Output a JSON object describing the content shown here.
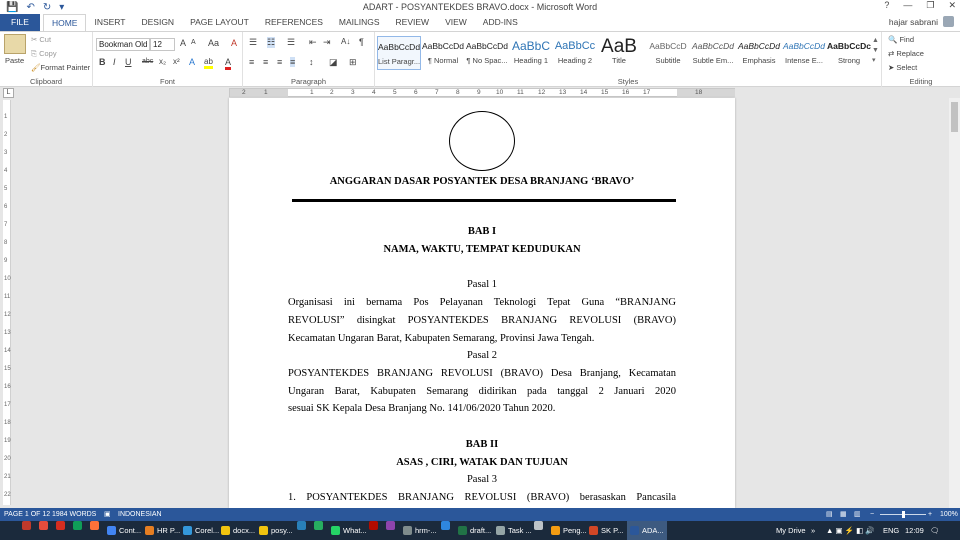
{
  "window": {
    "title": "ADART - POSYANTEKDES BRAVO.docx - Microsoft Word",
    "help": "?",
    "minimize": "—",
    "restore": "❐",
    "close": "✕"
  },
  "quick_access": {
    "save": "💾",
    "undo": "↶",
    "redo": "↻",
    "customize": "▾"
  },
  "tabs": [
    "FILE",
    "HOME",
    "INSERT",
    "DESIGN",
    "PAGE LAYOUT",
    "REFERENCES",
    "MAILINGS",
    "REVIEW",
    "VIEW",
    "ADD-INS"
  ],
  "user": {
    "name": "hajar sabrani"
  },
  "clipboard": {
    "paste": "Paste",
    "cut": "Cut",
    "copy": "Copy",
    "format_painter": "Format Painter",
    "label": "Clipboard"
  },
  "font": {
    "name": "Bookman Old",
    "size": "12",
    "label": "Font",
    "bold": "B",
    "italic": "I",
    "underline": "U",
    "strike": "abc",
    "sub": "x₂",
    "sup": "x²",
    "grow": "A",
    "shrink": "A",
    "case": "Aa",
    "clear": "A",
    "color": "A",
    "highlight": "ab"
  },
  "paragraph": {
    "label": "Paragraph",
    "show_marks": "¶",
    "sort": "A↓"
  },
  "styles": {
    "label": "Styles",
    "items": [
      {
        "preview": "AaBbCcDd",
        "name": "List Paragr..."
      },
      {
        "preview": "AaBbCcDd",
        "name": "¶ Normal"
      },
      {
        "preview": "AaBbCcDd",
        "name": "¶ No Spac..."
      },
      {
        "preview": "AaBbC",
        "name": "Heading 1"
      },
      {
        "preview": "AaBbCc",
        "name": "Heading 2"
      },
      {
        "preview": "AaB",
        "name": "Title"
      },
      {
        "preview": "AaBbCcD",
        "name": "Subtitle"
      },
      {
        "preview": "AaBbCcDd",
        "name": "Subtle Em..."
      },
      {
        "preview": "AaBbCcDd",
        "name": "Emphasis"
      },
      {
        "preview": "AaBbCcDd",
        "name": "Intense E..."
      },
      {
        "preview": "AaBbCcDc",
        "name": "Strong"
      }
    ]
  },
  "editing": {
    "label": "Editing",
    "find": "Find",
    "replace": "Replace",
    "select": "Select"
  },
  "ruler": {
    "ticks": [
      "2",
      "1",
      "1",
      "2",
      "3",
      "4",
      "5",
      "6",
      "7",
      "8",
      "9",
      "10",
      "11",
      "12",
      "13",
      "14",
      "15",
      "16",
      "17",
      "18"
    ]
  },
  "vruler": {
    "ticks": [
      "1",
      "2",
      "3",
      "4",
      "5",
      "6",
      "7",
      "8",
      "9",
      "10",
      "11",
      "12",
      "13",
      "14",
      "15",
      "16",
      "17",
      "18",
      "19",
      "20",
      "21",
      "22"
    ]
  },
  "doc": {
    "title": "ANGGARAN DASAR POSYANTEK DESA BRANJANG ‘BRAVO’",
    "bab1": "BAB I",
    "bab1_title": "NAMA, WAKTU, TEMPAT KEDUDUKAN",
    "pasal1": "Pasal 1",
    "p1_l1": "Organisasi ini bernama Pos Pelayanan Teknologi Tepat Guna “BRANJANG",
    "p1_l2": "REVOLUSI” disingkat POSYANTEKDES BRANJANG REVOLUSI (BRAVO)",
    "p1_l3": "Kecamatan Ungaran Barat, Kabupaten Semarang, Provinsi Jawa Tengah.",
    "pasal2": "Pasal 2",
    "p2_l1": "POSYANTEKDES BRANJANG REVOLUSI (BRAVO) Desa Branjang, Kecamatan",
    "p2_l2": "Ungaran Barat, Kabupaten Semarang didirikan pada tanggal  2 Januari 2020",
    "p2_l3": "sesuai SK Kepala Desa Branjang No. 141/06/2020 Tahun 2020.",
    "bab2": "BAB II",
    "bab2_title": "ASAS , CIRI, WATAK DAN TUJUAN",
    "pasal3": "Pasal 3",
    "p3_l1": "1.  POSYANTEKDES BRANJANG REVOLUSI (BRAVO) berasaskan Pancasila"
  },
  "status": {
    "page": "PAGE 1 OF 12",
    "words": "1984 WORDS",
    "language": "INDONESIAN",
    "zoom": "100%",
    "zoom_level": 100
  },
  "taskbar": {
    "items": [
      {
        "icon": "fs-icon",
        "label": "",
        "color": "#c0392b"
      },
      {
        "icon": "pdf-icon",
        "label": "",
        "color": "#e74c3c"
      },
      {
        "icon": "opera-icon",
        "label": "",
        "color": "#d62d20"
      },
      {
        "icon": "sheets-icon",
        "label": "",
        "color": "#0f9d58"
      },
      {
        "icon": "firefox-icon",
        "label": "",
        "color": "#ff7139"
      },
      {
        "icon": "chrome-icon",
        "label": "Cont...",
        "color": "#4285f4"
      },
      {
        "icon": "app-icon",
        "label": "HR P...",
        "color": "#e67e22"
      },
      {
        "icon": "corel-icon",
        "label": "Corel...",
        "color": "#3498db"
      },
      {
        "icon": "folder-icon",
        "label": "docx...",
        "color": "#f1c40f"
      },
      {
        "icon": "folder-icon",
        "label": "posy...",
        "color": "#f1c40f"
      },
      {
        "icon": "app-icon",
        "label": "",
        "color": "#2980b9"
      },
      {
        "icon": "camtasia-icon",
        "label": "",
        "color": "#27ae60"
      },
      {
        "icon": "whatsapp-icon",
        "label": "What...",
        "color": "#25d366"
      },
      {
        "icon": "acrobat-icon",
        "label": "",
        "color": "#b30b00"
      },
      {
        "icon": "app-icon",
        "label": "",
        "color": "#8e44ad"
      },
      {
        "icon": "app-icon",
        "label": "hrm-...",
        "color": "#7f8c8d"
      },
      {
        "icon": "edge-icon",
        "label": "",
        "color": "#2e86de"
      },
      {
        "icon": "excel-icon",
        "label": "draft...",
        "color": "#217346"
      },
      {
        "icon": "app-icon",
        "label": "Task ...",
        "color": "#95a5a6"
      },
      {
        "icon": "speed-icon",
        "label": "",
        "color": "#bdc3c7"
      },
      {
        "icon": "app-icon",
        "label": "Peng...",
        "color": "#f39c12"
      },
      {
        "icon": "powerpoint-icon",
        "label": "SK P...",
        "color": "#d24726"
      },
      {
        "icon": "word-icon",
        "label": "ADA...",
        "color": "#2b579a"
      }
    ],
    "drive": "My Drive",
    "tray_more": "»",
    "lang": "ENG",
    "time": "12:09"
  }
}
